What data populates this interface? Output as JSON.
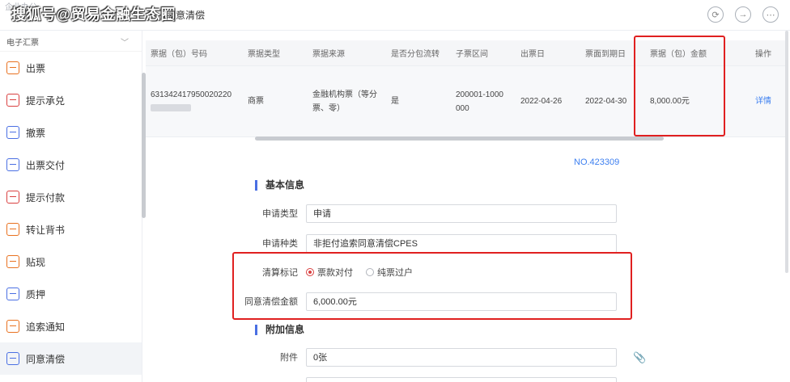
{
  "watermark": "搜狐号@贸易金融生态圈",
  "header": {
    "breadcrumb_faint": "企业办公",
    "tab_label": "同意清偿",
    "icons": [
      "refresh-icon",
      "exit-icon",
      "more-icon"
    ]
  },
  "sidebar": {
    "group_label": "电子汇票",
    "items": [
      {
        "label": "出票",
        "icon": "draw-bill-icon",
        "color": "#e8711f"
      },
      {
        "label": "提示承兑",
        "icon": "acceptance-icon",
        "color": "#d94040"
      },
      {
        "label": "撤票",
        "icon": "revoke-icon",
        "color": "#4a6fe3"
      },
      {
        "label": "出票交付",
        "icon": "delivery-icon",
        "color": "#4a6fe3"
      },
      {
        "label": "提示付款",
        "icon": "payment-icon",
        "color": "#d94040"
      },
      {
        "label": "转让背书",
        "icon": "endorse-icon",
        "color": "#e8711f"
      },
      {
        "label": "贴现",
        "icon": "discount-icon",
        "color": "#e8711f"
      },
      {
        "label": "质押",
        "icon": "pledge-icon",
        "color": "#4a6fe3"
      },
      {
        "label": "追索通知",
        "icon": "recourse-icon",
        "color": "#e8711f"
      },
      {
        "label": "同意清偿",
        "icon": "settle-icon",
        "color": "#4a6fe3"
      }
    ]
  },
  "table": {
    "headers": [
      "票据（包）号码",
      "票据类型",
      "票据来源",
      "是否分包流转",
      "子票区间",
      "出票日",
      "票面到期日",
      "票据（包）金额",
      "",
      "操作"
    ],
    "row": {
      "bill_no": "631342417950020220",
      "bill_type": "商票",
      "source_line1": "金融机构票（等分",
      "source_line2": "票、零）",
      "split": "是",
      "range_line1": "200001-1000",
      "range_line2": "000",
      "issue_date": "2022-04-26",
      "due_date": "2022-04-30",
      "amount": "8,000.00元",
      "action": "详情"
    }
  },
  "form": {
    "no_label": "NO.423309",
    "basic_section": "基本信息",
    "extra_section": "附加信息",
    "apply_type_label": "申请类型",
    "apply_type_value": "申请",
    "apply_kind_label": "申请种类",
    "apply_kind_value": "非拒付追索同意清偿CPES",
    "settle_mark_label": "清算标记",
    "settle_option_1": "票款对付",
    "settle_option_2": "纯票过户",
    "settle_amount_label": "同意清偿金额",
    "settle_amount_value": "6,000.00元",
    "attachment_label": "附件",
    "attachment_value": "0张"
  },
  "colors": {
    "highlight_box": "#e02020",
    "accent_blue": "#3d7ff0",
    "radio_checked": "#d94040"
  }
}
